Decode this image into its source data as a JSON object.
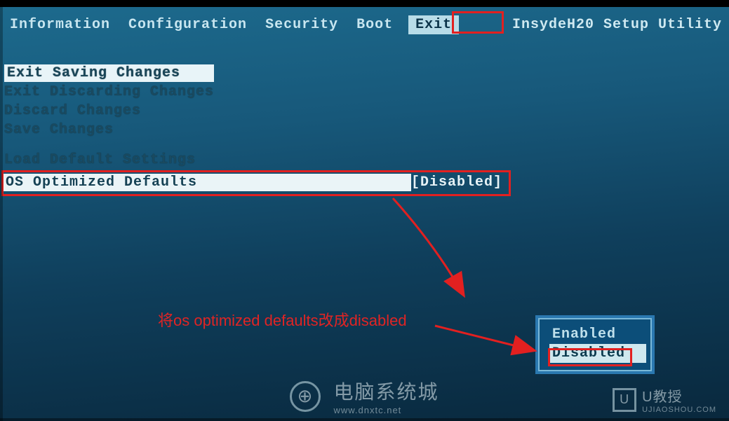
{
  "brand": "InsydeH20 Setup Utility",
  "menu": {
    "items": [
      "Information",
      "Configuration",
      "Security",
      "Boot",
      "Exit"
    ],
    "active_index": 4
  },
  "exit_options": [
    "Exit Saving Changes",
    "Exit Discarding Changes",
    "Discard Changes",
    "Save Changes"
  ],
  "extra_options": [
    "Load Default Settings"
  ],
  "selected_row": {
    "label": "OS Optimized Defaults",
    "value": "[Disabled]"
  },
  "popup": {
    "options": [
      "Enabled",
      "Disabled"
    ],
    "selected_index": 1
  },
  "annotation": {
    "text": "将os optimized defaults改成disabled"
  },
  "watermark": {
    "center": "电脑系统城",
    "center_sub": "www.dnxtc.net",
    "right_label": "U教授",
    "right_sub": "UJIAOSHOU.COM"
  }
}
